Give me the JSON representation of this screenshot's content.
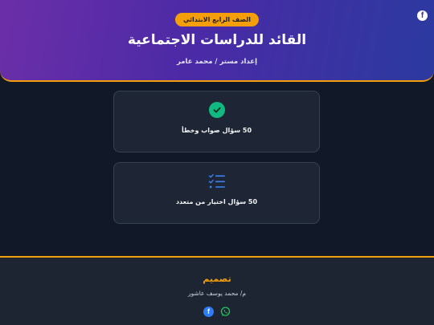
{
  "header": {
    "badge": "الصف الرابع الابتدائي",
    "title": "القائد للدراسات الاجتماعية",
    "subtitle": "إعداد مستر / محمد عامر",
    "social_icon": "facebook-icon"
  },
  "cards": [
    {
      "label": "50 سؤال صواب وخطأ",
      "icon": "check-circle-icon"
    },
    {
      "label": "50 سؤال اختيار من متعدد",
      "icon": "checklist-icon"
    }
  ],
  "footer": {
    "design_title": "تصميم",
    "designer": "م/ محمد يوسف عاشور",
    "socials": [
      "facebook-icon",
      "whatsapp-icon"
    ]
  },
  "colors": {
    "accent": "#f59e0b",
    "success": "#10b981",
    "link": "#3b82f6",
    "background": "#111827"
  }
}
